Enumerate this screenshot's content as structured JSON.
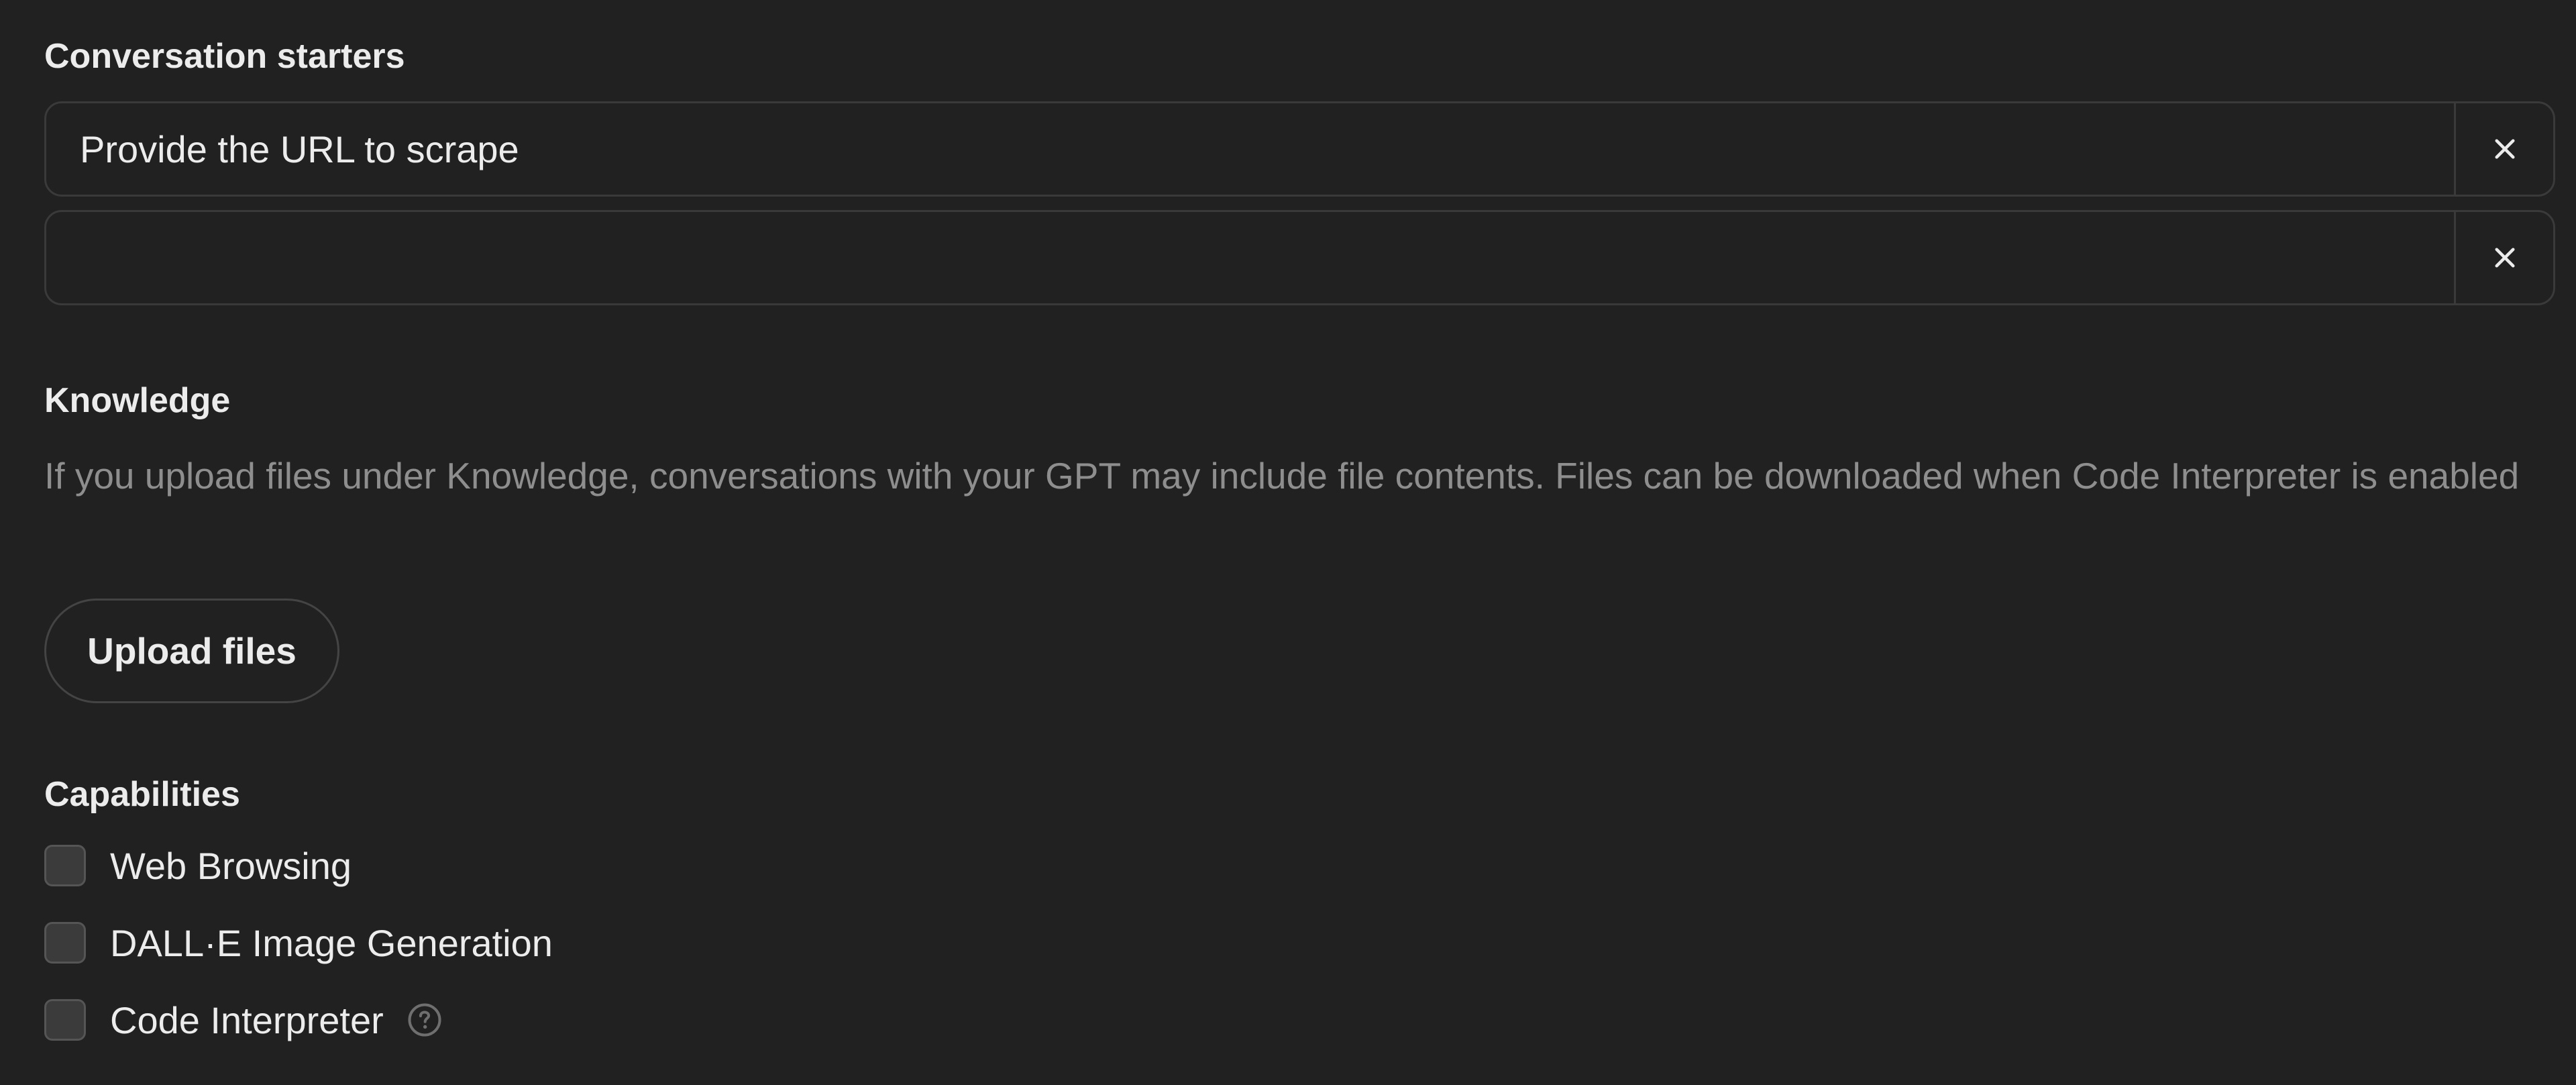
{
  "conversation_starters": {
    "title": "Conversation starters",
    "items": [
      {
        "value": "Provide the URL to scrape",
        "placeholder": ""
      },
      {
        "value": "",
        "placeholder": ""
      }
    ],
    "remove_icon": "close-icon"
  },
  "knowledge": {
    "title": "Knowledge",
    "description": "If you upload files under Knowledge, conversations with your GPT may include file contents. Files can be downloaded when Code Interpreter is enabled",
    "upload_label": "Upload files"
  },
  "capabilities": {
    "title": "Capabilities",
    "items": [
      {
        "label": "Web Browsing",
        "checked": false
      },
      {
        "label": "DALL·E Image Generation",
        "checked": false
      },
      {
        "label": "Code Interpreter",
        "checked": false,
        "help_icon": "question-mark-circle-icon"
      }
    ]
  },
  "colors": {
    "background": "#212121",
    "text": "#ececec",
    "muted_text": "#8e8e8e",
    "border": "#3a3a3a",
    "checkbox_fill": "#3b3b3b"
  }
}
